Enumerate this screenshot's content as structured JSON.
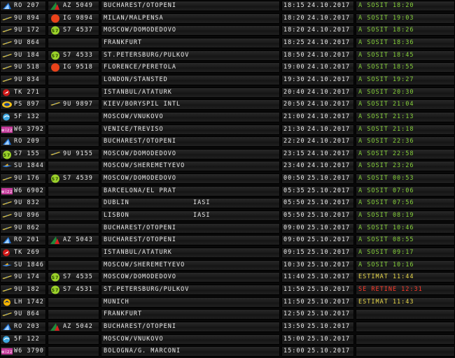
{
  "board": {
    "rows": [
      {
        "flight": "RO 207",
        "logo": "tarom",
        "cs_logo": "alitalia",
        "cs_code": "AZ 5049",
        "dest": "BUCHAREST/OTOPENI",
        "dest2": "",
        "time": "18:15",
        "date": "24.10.2017",
        "status": "A SOSIT 18:20",
        "status_class": "green"
      },
      {
        "flight": "9U 894",
        "logo": "airmoldova",
        "cs_logo": "orange-dot",
        "cs_code": "IG 9894",
        "dest": "MILAN/MALPENSA",
        "dest2": "",
        "time": "18:20",
        "date": "24.10.2017",
        "status": "A SOSIT 19:03",
        "status_class": "green"
      },
      {
        "flight": "9U 172",
        "logo": "airmoldova",
        "cs_logo": "s7",
        "cs_code": "S7 4537",
        "dest": "MOSCOW/DOMODEDOVO",
        "dest2": "",
        "time": "18:20",
        "date": "24.10.2017",
        "status": "A SOSIT 18:26",
        "status_class": "green"
      },
      {
        "flight": "9U 864",
        "logo": "airmoldova",
        "cs_logo": "",
        "cs_code": "",
        "dest": "FRANKFURT",
        "dest2": "",
        "time": "18:25",
        "date": "24.10.2017",
        "status": "A SOSIT 18:36",
        "status_class": "green"
      },
      {
        "flight": "9U 184",
        "logo": "airmoldova",
        "cs_logo": "s7",
        "cs_code": "S7 4533",
        "dest": "ST.PETERSBURG/PULKOV",
        "dest2": "",
        "time": "18:50",
        "date": "24.10.2017",
        "status": "A SOSIT 18:45",
        "status_class": "green"
      },
      {
        "flight": "9U 518",
        "logo": "airmoldova",
        "cs_logo": "orange-dot",
        "cs_code": "IG 9518",
        "dest": "FLORENCE/PERETOLA",
        "dest2": "",
        "time": "19:00",
        "date": "24.10.2017",
        "status": "A SOSIT 18:55",
        "status_class": "green"
      },
      {
        "flight": "9U 834",
        "logo": "airmoldova",
        "cs_logo": "",
        "cs_code": "",
        "dest": "LONDON/STANSTED",
        "dest2": "",
        "time": "19:30",
        "date": "24.10.2017",
        "status": "A SOSIT 19:27",
        "status_class": "green"
      },
      {
        "flight": "TK 271",
        "logo": "turkish",
        "cs_logo": "",
        "cs_code": "",
        "dest": "ISTANBUL/ATATURK",
        "dest2": "",
        "time": "20:40",
        "date": "24.10.2017",
        "status": "A SOSIT 20:30",
        "status_class": "green"
      },
      {
        "flight": "PS 897",
        "logo": "uia",
        "cs_logo": "airmoldova",
        "cs_code": "9U 9897",
        "dest": "KIEV/BORYSPIL INTL",
        "dest2": "",
        "time": "20:50",
        "date": "24.10.2017",
        "status": "A SOSIT 21:04",
        "status_class": "green"
      },
      {
        "flight": "5F 132",
        "logo": "flyone",
        "cs_logo": "",
        "cs_code": "",
        "dest": "MOSCOW/VNUKOVO",
        "dest2": "",
        "time": "21:00",
        "date": "24.10.2017",
        "status": "A SOSIT 21:13",
        "status_class": "green"
      },
      {
        "flight": "W6 3792",
        "logo": "wizz",
        "cs_logo": "",
        "cs_code": "",
        "dest": "VENICE/TREVISO",
        "dest2": "",
        "time": "21:30",
        "date": "24.10.2017",
        "status": "A SOSIT 21:18",
        "status_class": "green"
      },
      {
        "flight": "RO 209",
        "logo": "tarom",
        "cs_logo": "",
        "cs_code": "",
        "dest": "BUCHAREST/OTOPENI",
        "dest2": "",
        "time": "22:20",
        "date": "24.10.2017",
        "status": "A SOSIT 22:36",
        "status_class": "green"
      },
      {
        "flight": "S7 155",
        "logo": "s7",
        "cs_logo": "airmoldova",
        "cs_code": "9U 9155",
        "dest": "MOSCOW/DOMODEDOVO",
        "dest2": "",
        "time": "23:15",
        "date": "24.10.2017",
        "status": "A SOSIT 22:58",
        "status_class": "green"
      },
      {
        "flight": "SU 1844",
        "logo": "aeroflot",
        "cs_logo": "",
        "cs_code": "",
        "dest": "MOSCOW/SHEREMETYEVO",
        "dest2": "",
        "time": "23:40",
        "date": "24.10.2017",
        "status": "A SOSIT 23:26",
        "status_class": "green"
      },
      {
        "flight": "9U 176",
        "logo": "airmoldova",
        "cs_logo": "s7",
        "cs_code": "S7 4539",
        "dest": "MOSCOW/DOMODEDOVO",
        "dest2": "",
        "time": "00:50",
        "date": "25.10.2017",
        "status": "A SOSIT 00:53",
        "status_class": "green"
      },
      {
        "flight": "W6 6902",
        "logo": "wizz",
        "cs_logo": "",
        "cs_code": "",
        "dest": "BARCELONA/EL PRAT",
        "dest2": "",
        "time": "05:35",
        "date": "25.10.2017",
        "status": "A SOSIT 07:06",
        "status_class": "green"
      },
      {
        "flight": "9U 832",
        "logo": "airmoldova",
        "cs_logo": "",
        "cs_code": "",
        "dest": "DUBLIN",
        "dest2": "IASI",
        "time": "05:50",
        "date": "25.10.2017",
        "status": "A SOSIT 07:56",
        "status_class": "green"
      },
      {
        "flight": "9U 896",
        "logo": "airmoldova",
        "cs_logo": "",
        "cs_code": "",
        "dest": "LISBON",
        "dest2": "IASI",
        "time": "05:50",
        "date": "25.10.2017",
        "status": "A SOSIT 08:19",
        "status_class": "green"
      },
      {
        "flight": "9U 862",
        "logo": "airmoldova",
        "cs_logo": "",
        "cs_code": "",
        "dest": "BUCHAREST/OTOPENI",
        "dest2": "",
        "time": "09:00",
        "date": "25.10.2017",
        "status": "A SOSIT 10:46",
        "status_class": "green"
      },
      {
        "flight": "RO 201",
        "logo": "tarom",
        "cs_logo": "alitalia",
        "cs_code": "AZ 5043",
        "dest": "BUCHAREST/OTOPENI",
        "dest2": "",
        "time": "09:00",
        "date": "25.10.2017",
        "status": "A SOSIT 08:55",
        "status_class": "green"
      },
      {
        "flight": "TK 269",
        "logo": "turkish",
        "cs_logo": "",
        "cs_code": "",
        "dest": "ISTANBUL/ATATURK",
        "dest2": "",
        "time": "09:15",
        "date": "25.10.2017",
        "status": "A SOSIT 09:17",
        "status_class": "green"
      },
      {
        "flight": "SU 1846",
        "logo": "aeroflot",
        "cs_logo": "",
        "cs_code": "",
        "dest": "MOSCOW/SHEREMETYEVO",
        "dest2": "",
        "time": "10:30",
        "date": "25.10.2017",
        "status": "A SOSIT 10:16",
        "status_class": "green"
      },
      {
        "flight": "9U 174",
        "logo": "airmoldova",
        "cs_logo": "s7",
        "cs_code": "S7 4535",
        "dest": "MOSCOW/DOMODEDOVO",
        "dest2": "",
        "time": "11:40",
        "date": "25.10.2017",
        "status": "ESTIMAT 11:44",
        "status_class": "yellow"
      },
      {
        "flight": "9U 182",
        "logo": "airmoldova",
        "cs_logo": "s7",
        "cs_code": "S7 4531",
        "dest": "ST.PETERSBURG/PULKOV",
        "dest2": "",
        "time": "11:50",
        "date": "25.10.2017",
        "status": "SE RETINE 12:31",
        "status_class": "red"
      },
      {
        "flight": "LH 1742",
        "logo": "lufthansa",
        "cs_logo": "",
        "cs_code": "",
        "dest": "MUNICH",
        "dest2": "",
        "time": "11:50",
        "date": "25.10.2017",
        "status": "ESTIMAT 11:43",
        "status_class": "yellow"
      },
      {
        "flight": "9U 864",
        "logo": "airmoldova",
        "cs_logo": "",
        "cs_code": "",
        "dest": "FRANKFURT",
        "dest2": "",
        "time": "12:50",
        "date": "25.10.2017",
        "status": "",
        "status_class": ""
      },
      {
        "flight": "RO 203",
        "logo": "tarom",
        "cs_logo": "alitalia",
        "cs_code": "AZ 5042",
        "dest": "BUCHAREST/OTOPENI",
        "dest2": "",
        "time": "13:50",
        "date": "25.10.2017",
        "status": "",
        "status_class": ""
      },
      {
        "flight": "5F 122",
        "logo": "flyone",
        "cs_logo": "",
        "cs_code": "",
        "dest": "MOSCOW/VNUKOVO",
        "dest2": "",
        "time": "15:00",
        "date": "25.10.2017",
        "status": "",
        "status_class": ""
      },
      {
        "flight": "W6 3790",
        "logo": "wizz",
        "cs_logo": "",
        "cs_code": "",
        "dest": "BOLOGNA/G. MARCONI",
        "dest2": "",
        "time": "15:00",
        "date": "25.10.2017",
        "status": "",
        "status_class": ""
      }
    ]
  },
  "colors": {
    "status_green": "#86d23a",
    "status_yellow": "#e8d84a",
    "status_red": "#ff3a2a",
    "text": "#ececec"
  }
}
